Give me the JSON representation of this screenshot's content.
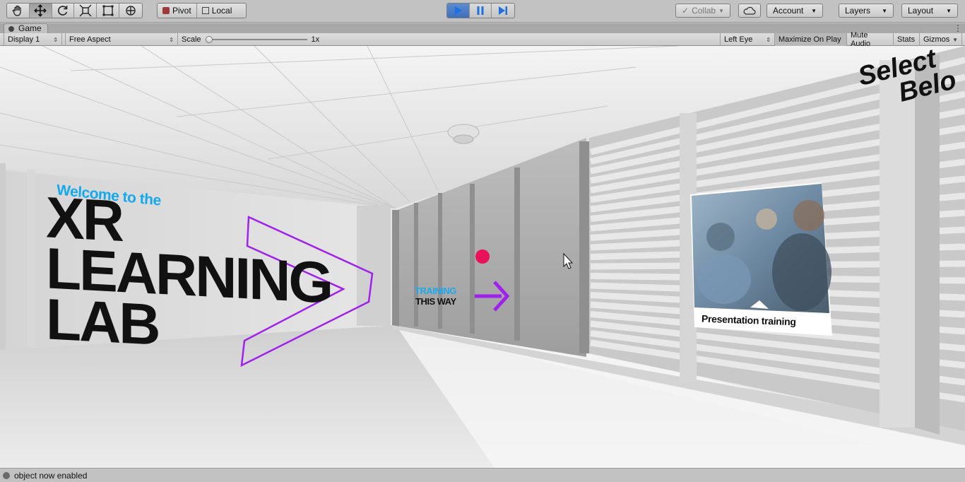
{
  "toolbar": {
    "transform_tools": [
      {
        "name": "hand-tool-icon"
      },
      {
        "name": "move-tool-icon"
      },
      {
        "name": "rotate-tool-icon"
      },
      {
        "name": "scale-tool-icon"
      },
      {
        "name": "rect-tool-icon"
      },
      {
        "name": "transform-tool-icon"
      }
    ],
    "pivot_label": "Pivot",
    "local_label": "Local",
    "play_controls": {
      "play": "play-icon",
      "pause": "pause-icon",
      "step": "step-icon"
    },
    "collab_label": "Collab",
    "account_label": "Account",
    "layers_label": "Layers",
    "layout_label": "Layout"
  },
  "tab": {
    "game_label": "Game"
  },
  "game_bar": {
    "display": "Display 1",
    "aspect": "Free Aspect",
    "scale_label": "Scale",
    "scale_value": "1x",
    "eye": "Left Eye",
    "maximize": "Maximize On Play",
    "mute": "Mute Audio",
    "stats": "Stats",
    "gizmos": "Gizmos"
  },
  "scene": {
    "welcome": "Welcome to the",
    "title_lines": [
      "XR",
      "LEARNING",
      "LAB"
    ],
    "training_line1": "TRAINING",
    "training_line2": "THIS WAY",
    "select_lines": [
      "Select",
      "Belo"
    ],
    "poster_caption": "Presentation training",
    "accent_purple": "#a020f0",
    "accent_blue": "#13a9ef",
    "marker_color": "#e8115a"
  },
  "status": {
    "message": "object now enabled"
  }
}
